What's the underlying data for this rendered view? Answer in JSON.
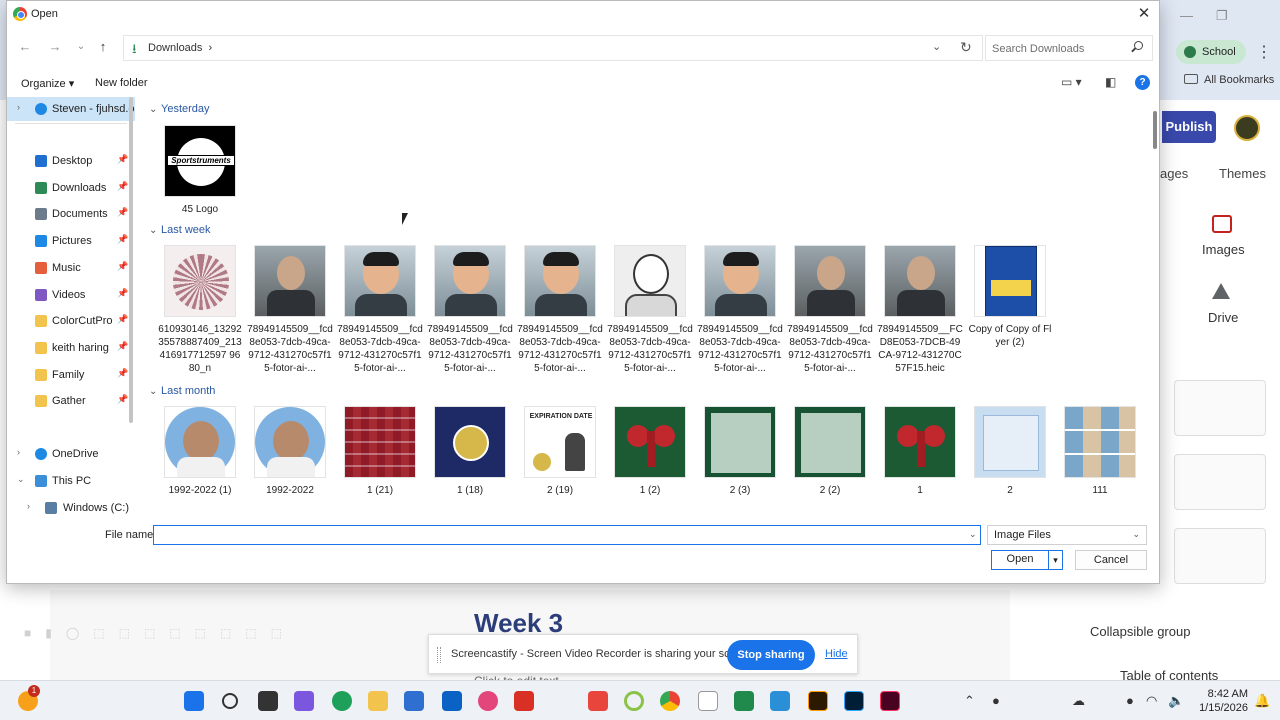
{
  "dialog": {
    "title": "Open",
    "address_crumb": "Downloads",
    "search_placeholder": "Search Downloads",
    "organize_label": "Organize ▾",
    "new_folder_label": "New folder",
    "file_name_label": "File name:",
    "file_name_value": "",
    "file_type_value": "Image Files",
    "open_label": "Open",
    "cancel_label": "Cancel"
  },
  "nav": {
    "cloud_account": "Steven - fjuhsd.o",
    "quick_access": [
      {
        "label": "Desktop",
        "icon": "desktop-icon",
        "color": "#1f6fd1"
      },
      {
        "label": "Downloads",
        "icon": "download-icon",
        "color": "#2e8b57"
      },
      {
        "label": "Documents",
        "icon": "document-icon",
        "color": "#6b7b8c"
      },
      {
        "label": "Pictures",
        "icon": "pictures-icon",
        "color": "#1e88e5"
      },
      {
        "label": "Music",
        "icon": "music-icon",
        "color": "#e65f3c"
      },
      {
        "label": "Videos",
        "icon": "videos-icon",
        "color": "#7e57c2"
      },
      {
        "label": "ColorCutPro",
        "icon": "folder-icon",
        "color": "#f2c44d"
      },
      {
        "label": "keith haring",
        "icon": "folder-icon",
        "color": "#f2c44d"
      },
      {
        "label": "Family",
        "icon": "folder-icon",
        "color": "#f2c44d"
      },
      {
        "label": "Gather",
        "icon": "folder-icon",
        "color": "#f2c44d"
      }
    ],
    "onedrive": "OneDrive",
    "this_pc": "This PC",
    "windows_drive": "Windows (C:)"
  },
  "groups": {
    "yesterday": {
      "header": "Yesterday",
      "files": [
        {
          "name": "45 Logo",
          "thumb": "logo"
        }
      ]
    },
    "last_week": {
      "header": "Last week",
      "files": [
        {
          "name": "610930146_1329235578887409_213416917712597 9680_n",
          "thumb": "mandala"
        },
        {
          "name": "78949145509__fcd8e053-7dcb-49ca-9712-431270c57f15-fotor-ai-...",
          "thumb": "photo"
        },
        {
          "name": "78949145509__fcd8e053-7dcb-49ca-9712-431270c57f15-fotor-ai-...",
          "thumb": "cartoon"
        },
        {
          "name": "78949145509__fcd8e053-7dcb-49ca-9712-431270c57f15-fotor-ai-...",
          "thumb": "cartoon"
        },
        {
          "name": "78949145509__fcd8e053-7dcb-49ca-9712-431270c57f15-fotor-ai-...",
          "thumb": "cartoon"
        },
        {
          "name": "78949145509__fcd8e053-7dcb-49ca-9712-431270c57f15-fotor-ai-...",
          "thumb": "sketch"
        },
        {
          "name": "78949145509__fcd8e053-7dcb-49ca-9712-431270c57f15-fotor-ai-...",
          "thumb": "cartoon"
        },
        {
          "name": "78949145509__fcd8e053-7dcb-49ca-9712-431270c57f15-fotor-ai-...",
          "thumb": "photo"
        },
        {
          "name": "78949145509__FCD8E053-7DCB-49CA-9712-431270C57F15.heic",
          "thumb": "photo"
        },
        {
          "name": "Copy of Copy of Flyer (2)",
          "thumb": "flyer"
        }
      ]
    },
    "last_month": {
      "header": "Last month",
      "files": [
        {
          "name": "1992-2022 (1)",
          "thumb": "portrait"
        },
        {
          "name": "1992-2022",
          "thumb": "portrait"
        },
        {
          "name": "1 (21)",
          "thumb": "redpattern"
        },
        {
          "name": "1 (18)",
          "thumb": "navyseal"
        },
        {
          "name": "2 (19)",
          "thumb": "expiration"
        },
        {
          "name": "1 (2)",
          "thumb": "bow"
        },
        {
          "name": "2 (3)",
          "thumb": "greenframe"
        },
        {
          "name": "2 (2)",
          "thumb": "greenframe"
        },
        {
          "name": "1",
          "thumb": "bow"
        },
        {
          "name": "2",
          "thumb": "lightblue"
        },
        {
          "name": "111",
          "thumb": "collage"
        }
      ]
    }
  },
  "thumb_text": {
    "logo": "Sportstruments",
    "expiration": "EXPIRATION DATE"
  },
  "background": {
    "school_chip": "School",
    "all_bookmarks": "All Bookmarks",
    "publish": "Publish",
    "tab_pages": "ages",
    "tab_themes": "Themes",
    "images_label": "Images",
    "drive_label": "Drive",
    "collapsible_group": "Collapsible group",
    "toc": "Table of contents",
    "week_title": "Week 3",
    "click_to_edit": "Click to edit text"
  },
  "sharebar": {
    "message": "Screencastify - Screen Video Recorder is sharing your screen.",
    "stop": "Stop sharing",
    "hide": "Hide"
  },
  "taskbar": {
    "time": "8:42 AM",
    "date": "1/15/2026",
    "badge": "1"
  },
  "colors": {
    "accent": "#1a73e8",
    "group_header": "#2a58a4",
    "publish": "#3949ab"
  }
}
